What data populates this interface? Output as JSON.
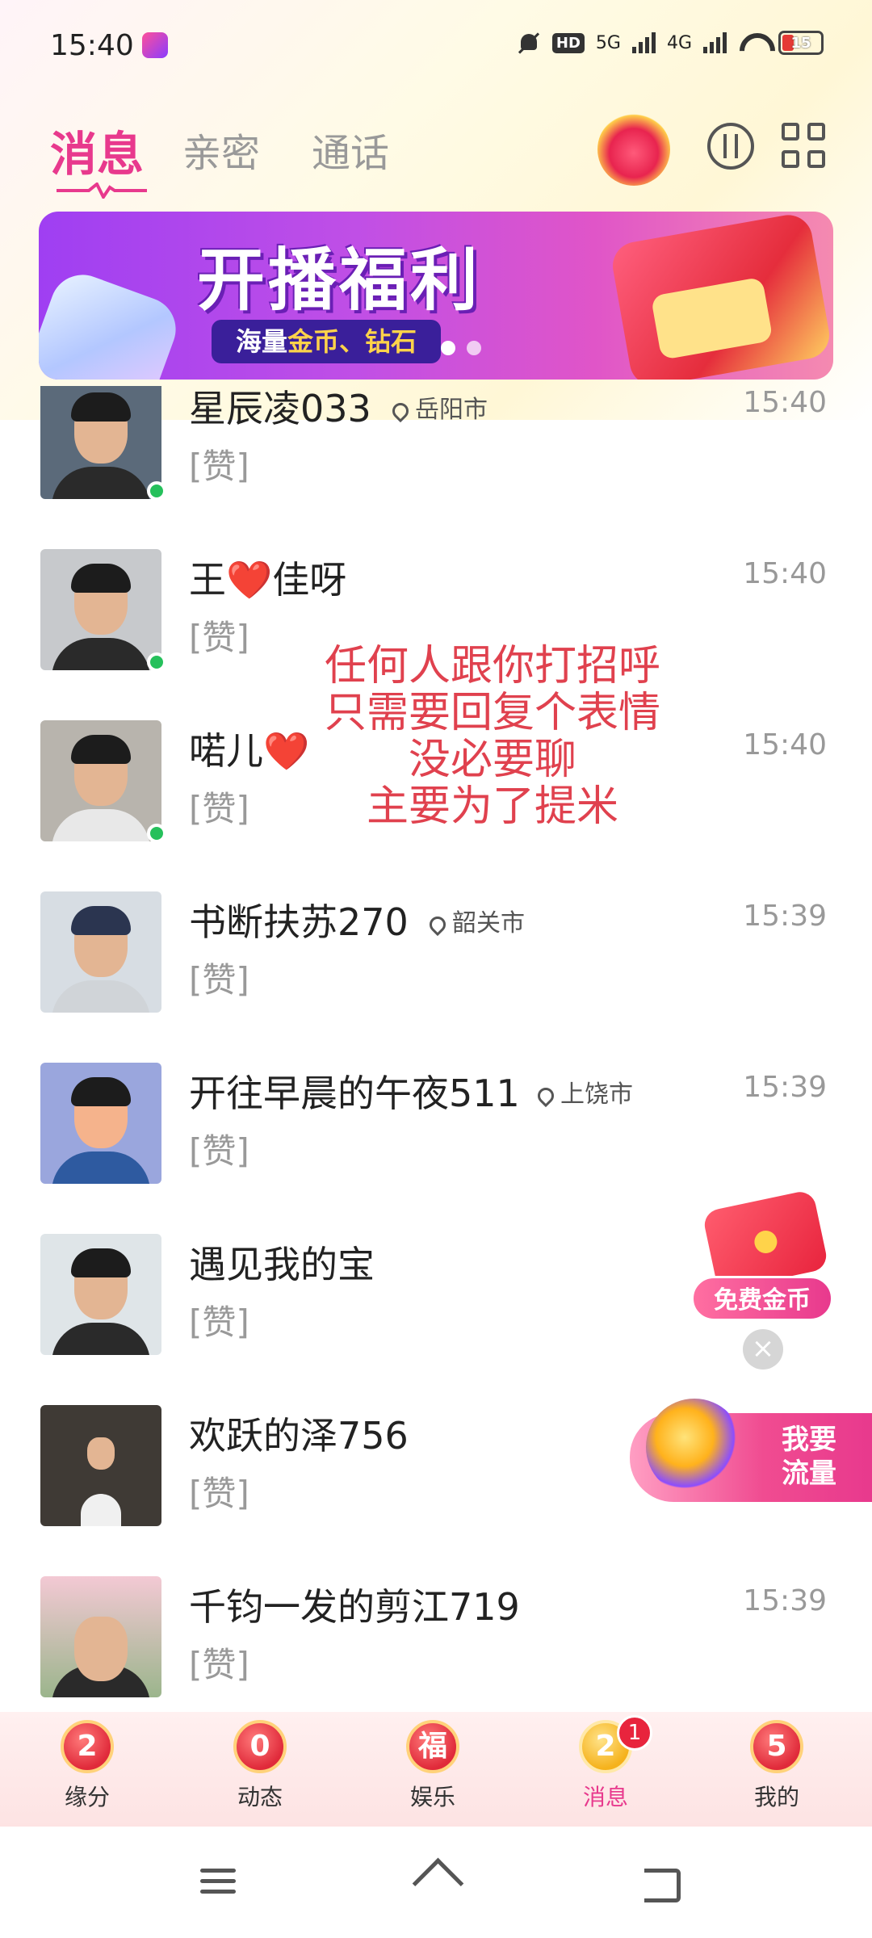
{
  "status_bar": {
    "time": "15:40",
    "network_hd": "HD",
    "network_5g": "5G",
    "network_4g": "4G",
    "battery": "15"
  },
  "header": {
    "tabs": [
      {
        "label": "消息",
        "active": true
      },
      {
        "label": "亲密",
        "active": false
      },
      {
        "label": "通话",
        "active": false
      }
    ],
    "icons": [
      "crown-badge-icon",
      "swap-icon",
      "grid-icon"
    ]
  },
  "banner": {
    "title": "开播福利",
    "subtitle_prefix": "海量",
    "subtitle_highlight": "金币、钻石",
    "slide_count": 2,
    "active_slide": 0
  },
  "messages": [
    {
      "name": "星辰凌033",
      "location": "岳阳市",
      "preview": "[赞]",
      "time": "15:40",
      "online": true
    },
    {
      "name_prefix": "王",
      "name_suffix": "佳呀",
      "heart": "❤️",
      "location": "",
      "preview": "[赞]",
      "time": "15:40",
      "online": true
    },
    {
      "name_prefix": "喏儿",
      "heart": "❤️",
      "location": "",
      "preview": "[赞]",
      "time": "15:40",
      "online": true
    },
    {
      "name": "书断扶苏270",
      "location": "韶关市",
      "preview": "[赞]",
      "time": "15:39",
      "online": false
    },
    {
      "name": "开往早晨的午夜511",
      "location": "上饶市",
      "preview": "[赞]",
      "time": "15:39",
      "online": false
    },
    {
      "name": "遇见我的宝",
      "location": "",
      "preview": "[赞]",
      "time": "",
      "online": false
    },
    {
      "name": "欢跃的泽756",
      "location": "",
      "preview": "[赞]",
      "time": "",
      "online": false
    },
    {
      "name": "千钧一发的剪江719",
      "location": "",
      "preview": "[赞]",
      "time": "15:39",
      "online": false
    }
  ],
  "overlay_caption": [
    "任何人跟你打招呼",
    "只需要回复个表情",
    "没必要聊",
    "主要为了提米"
  ],
  "floating": {
    "coin_label": "免费金币",
    "close_symbol": "×",
    "traffic_label_line1": "我要",
    "traffic_label_line2": "流量"
  },
  "bottom_nav": [
    {
      "badge": "2",
      "label": "缘分",
      "active": false
    },
    {
      "badge": "0",
      "label": "动态",
      "active": false
    },
    {
      "badge": "福",
      "label": "娱乐",
      "active": false
    },
    {
      "badge": "2",
      "label": "消息",
      "active": true,
      "dot": "1"
    },
    {
      "badge": "5",
      "label": "我的",
      "active": false
    }
  ],
  "colors": {
    "accent": "#e8398d",
    "online": "#25c05b",
    "overlay_text": "#e0414e"
  }
}
